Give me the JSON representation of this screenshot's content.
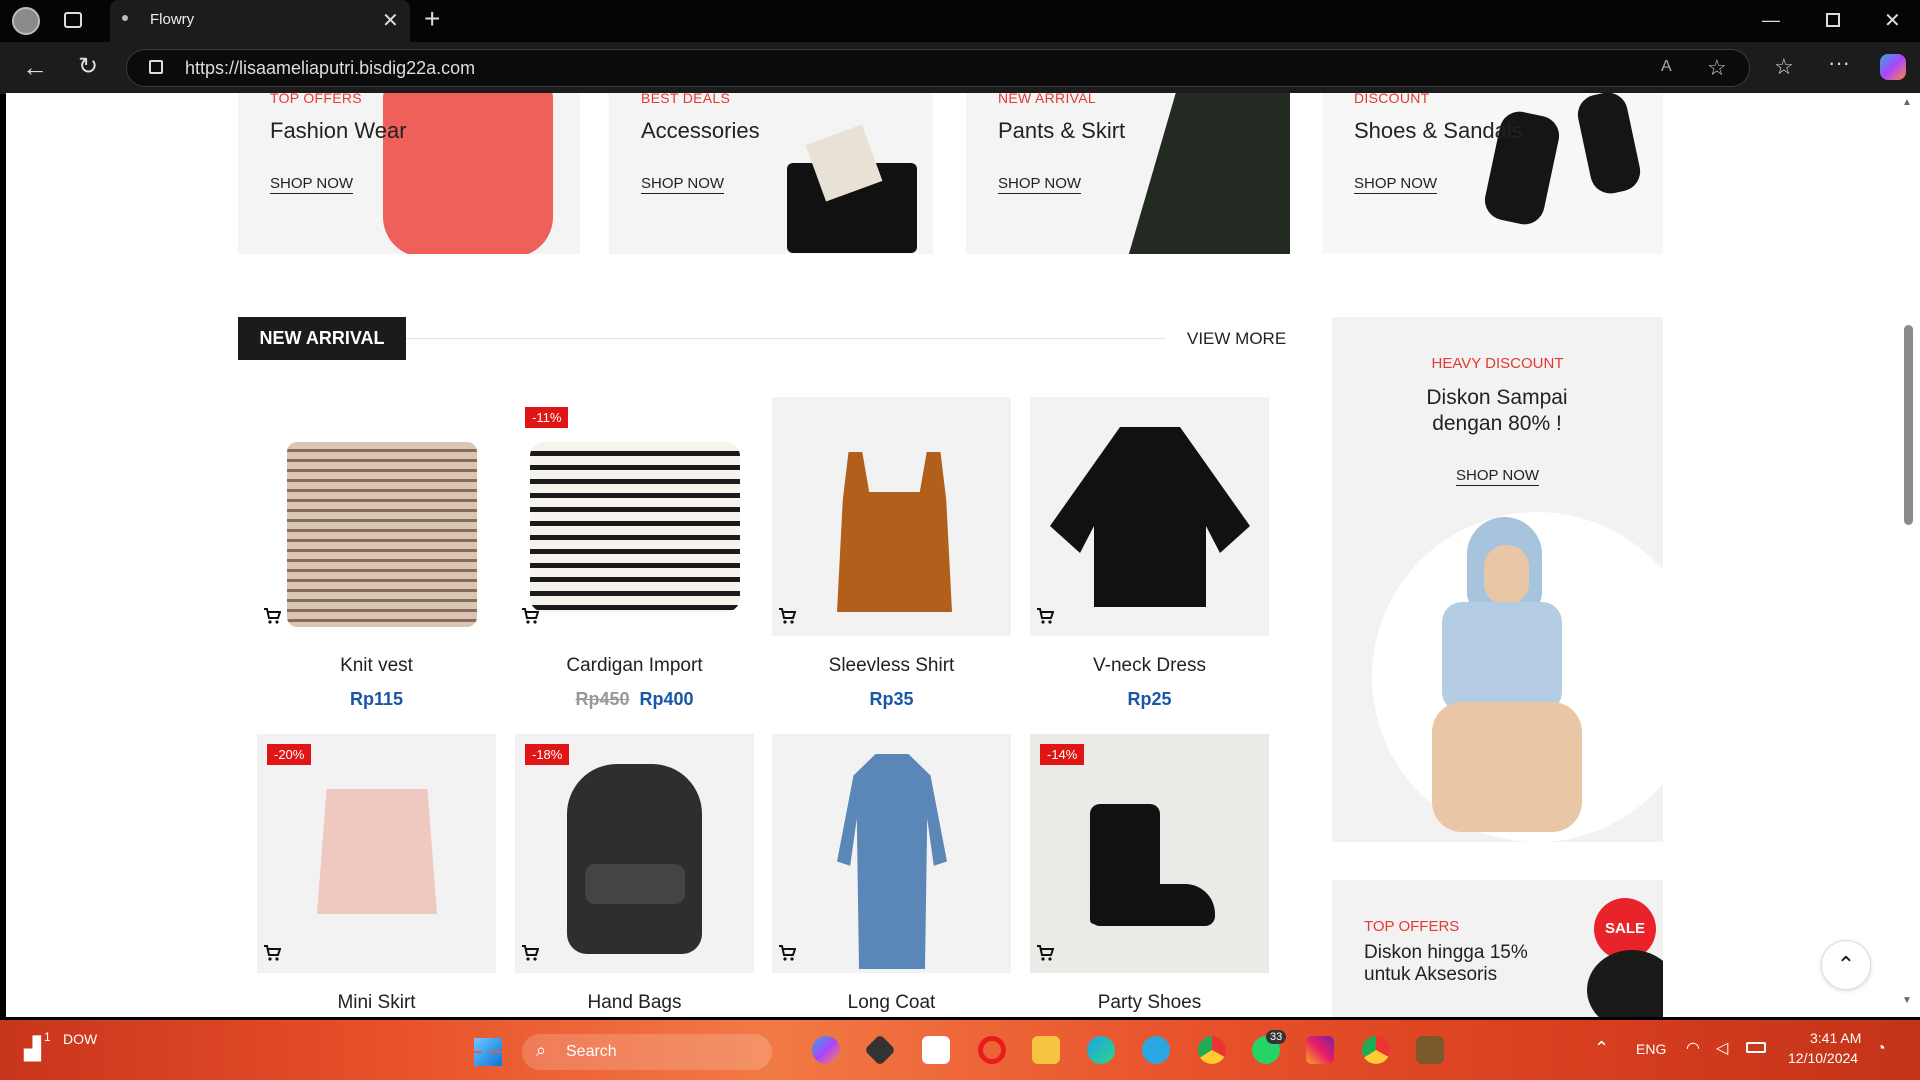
{
  "browser": {
    "tab_title": "Flowry",
    "url": "https://lisaameliaputri.bisdig22a.com"
  },
  "promos": [
    {
      "tag": "TOP OFFERS",
      "title": "Fashion Wear",
      "cta": "SHOP NOW"
    },
    {
      "tag": "BEST DEALS",
      "title": "Accessories",
      "cta": "SHOP NOW"
    },
    {
      "tag": "NEW ARRIVAL",
      "title": "Pants & Skirt",
      "cta": "SHOP NOW"
    },
    {
      "tag": "DISCOUNT",
      "title": "Shoes & Sandals",
      "cta": "SHOP NOW"
    }
  ],
  "new_arrival": {
    "heading": "NEW ARRIVAL",
    "view_more": "VIEW MORE",
    "products": [
      {
        "name": "Knit vest",
        "price": "Rp115",
        "old_price": "",
        "discount": ""
      },
      {
        "name": "Cardigan Import",
        "price": "Rp400",
        "old_price": "Rp450",
        "discount": "-11%"
      },
      {
        "name": "Sleevless Shirt",
        "price": "Rp35",
        "old_price": "",
        "discount": ""
      },
      {
        "name": "V-neck Dress",
        "price": "Rp25",
        "old_price": "",
        "discount": ""
      },
      {
        "name": "Mini Skirt",
        "price": "",
        "old_price": "",
        "discount": "-20%"
      },
      {
        "name": "Hand Bags",
        "price": "",
        "old_price": "",
        "discount": "-18%"
      },
      {
        "name": "Long Coat",
        "price": "",
        "old_price": "",
        "discount": ""
      },
      {
        "name": "Party Shoes",
        "price": "",
        "old_price": "",
        "discount": "-14%"
      }
    ]
  },
  "sidebar_banner": {
    "tag": "HEAVY DISCOUNT",
    "title": "Diskon Sampai dengan 80% !",
    "cta": "SHOP NOW"
  },
  "sidebar_banner2": {
    "tag": "TOP OFFERS",
    "title": "Diskon hingga 15% untuk Aksesoris",
    "sale": "SALE"
  },
  "taskbar": {
    "weather_label": "DOW",
    "weather_badge": "1",
    "search_label": "Search",
    "whatsapp_badge": "33",
    "language": "ENG",
    "time": "3:41 AM",
    "date": "12/10/2024"
  },
  "colors": {
    "accent_red": "#e53935",
    "price_blue": "#1a56a8",
    "taskbar": "#e8502a"
  }
}
